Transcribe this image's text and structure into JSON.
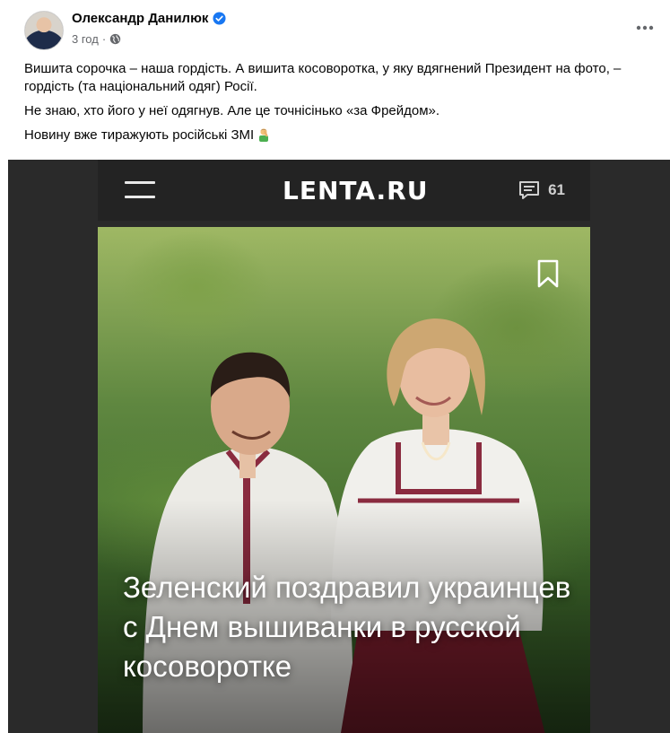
{
  "post": {
    "author": "Олександр Данилюк",
    "time": "3 год",
    "dot": "·",
    "paragraphs": [
      "Вишита сорочка – наша гордість. А вишита косоворотка, у яку вдягнений Президент на фото, – гордість (та національний одяг) Росії.",
      "Не знаю, хто його у неї одягнув. Але це точнісінько «за Фрейдом».",
      "Новину вже тиражують російські ЗМІ"
    ],
    "emoji": "person-facepalming-icon"
  },
  "embed": {
    "logo": "LENTA.RU",
    "comment_count": "61",
    "headline": "Зеленский поздравил украинцев с Днем вышиванки в русской косоворотке"
  },
  "colors": {
    "verified": "#1877f2",
    "meta_gray": "#65676b",
    "lenta_bar": "#232323"
  }
}
